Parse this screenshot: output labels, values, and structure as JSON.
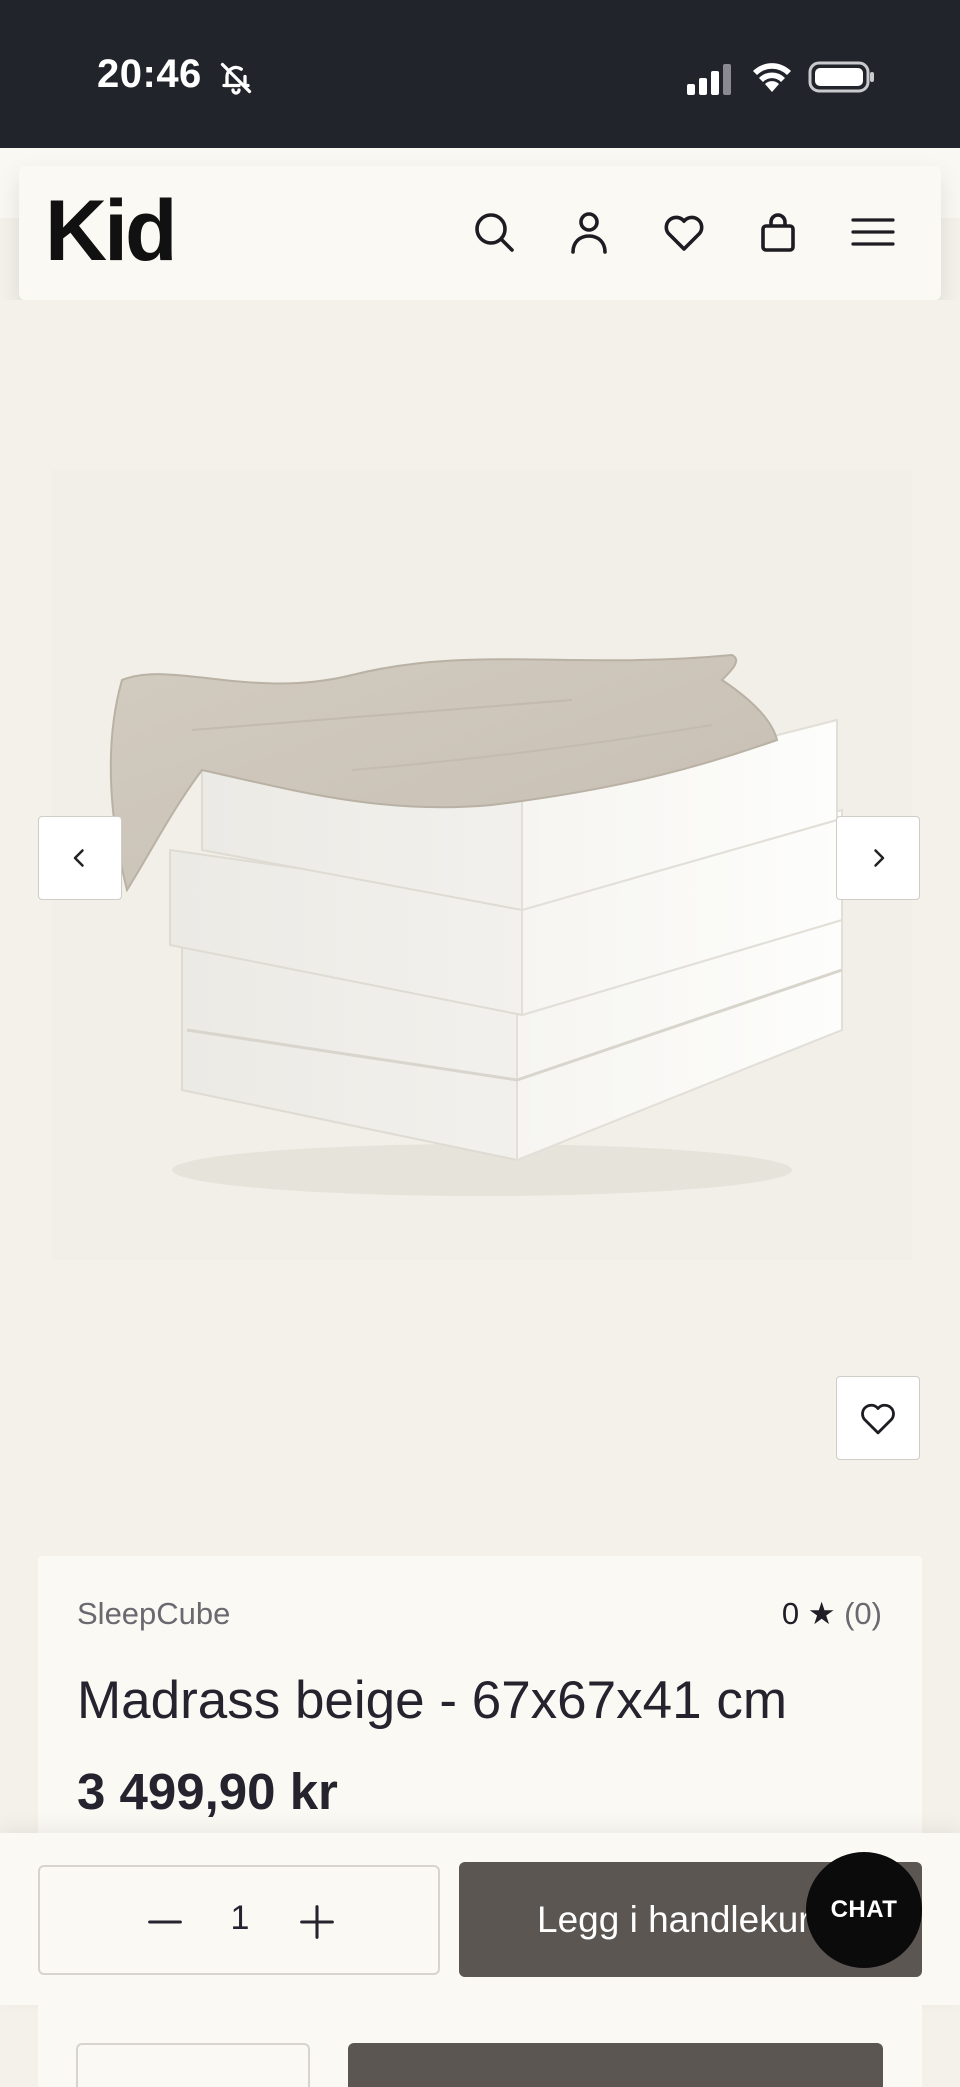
{
  "status_bar": {
    "time": "20:46",
    "icons": [
      "bell-off-icon",
      "signal-icon",
      "wifi-icon",
      "battery-icon"
    ]
  },
  "header": {
    "logo": "Kid",
    "icons": [
      "search-icon",
      "account-icon",
      "wishlist-icon",
      "cart-icon",
      "menu-icon"
    ]
  },
  "gallery": {
    "image_alt": "",
    "prev_icon": "chevron-left-icon",
    "next_icon": "chevron-right-icon",
    "favorite_icon": "heart-icon"
  },
  "product": {
    "brand": "SleepCube",
    "rating_value": "0",
    "rating_star": "★",
    "rating_count": "(0)",
    "title": "Madrass beige - 67x67x41 cm",
    "price": "3 499,90 kr"
  },
  "purchase": {
    "quantity": "1",
    "add_to_cart_label": "Legg i handlekurv"
  },
  "chat": {
    "label": "CHAT"
  },
  "colors": {
    "page_bg": "#f3f1ea",
    "card_bg": "#fbf9f4",
    "status_bar_bg": "#22242b",
    "button_dark": "#5c5652",
    "chat_bg": "#0b0b0c",
    "text_primary": "#25232e",
    "text_muted": "#6b6970"
  }
}
